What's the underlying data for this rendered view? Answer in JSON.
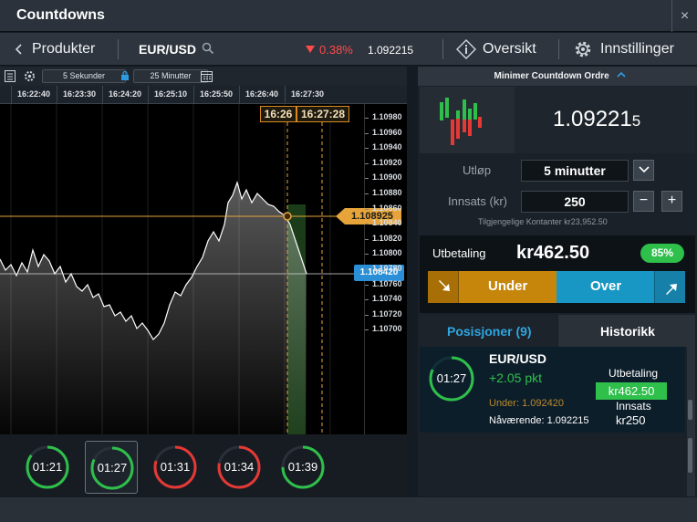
{
  "window": {
    "title": "Countdowns",
    "close_icon": "×"
  },
  "nav": {
    "back_label": "Produkter",
    "symbol": "EUR/USD",
    "change": "0.38%",
    "price": "1.092215",
    "overview_label": "Oversikt",
    "settings_label": "Innstillinger"
  },
  "chart_toolbar": {
    "interval": "5 Sekunder",
    "duration": "25 Minutter"
  },
  "time_axis": [
    "16:22:40",
    "16:23:30",
    "16:24:20",
    "16:25:10",
    "16:25:50",
    "16:26:40",
    "16:27:30"
  ],
  "marker_times": {
    "entry": "16:26",
    "expiry": "16:27:28"
  },
  "y_axis": [
    "1.10980",
    "1.10960",
    "1.10940",
    "1.10920",
    "1.10900",
    "1.10880",
    "1.10860",
    "1.10840",
    "1.10820",
    "1.10800",
    "1.10780",
    "1.10760",
    "1.10740",
    "1.10720",
    "1.10700"
  ],
  "price_tags": {
    "strike": "1.108925",
    "current": "1.108420"
  },
  "timers": [
    "01:21",
    "01:27",
    "01:31",
    "01:34",
    "01:39"
  ],
  "timer_progress": [
    0.85,
    0.82,
    0.8,
    0.78,
    0.75
  ],
  "order": {
    "header": "Minimer Countdown Ordre",
    "big_price_main": "1.09221",
    "big_price_small": "5",
    "expiry_label": "Utløp",
    "expiry_value": "5 minutter",
    "stake_label": "Innsats (kr)",
    "stake_value": "250",
    "available": "Tilgjengelige Kontanter kr23,952.50",
    "payout_label": "Utbetaling",
    "payout_value": "kr462.50",
    "payout_pct": "85%",
    "under_label": "Under",
    "over_label": "Over",
    "minus": "−",
    "plus": "+"
  },
  "tabs": {
    "positions": "Posisjoner (9)",
    "history": "Historikk"
  },
  "position": {
    "timer": "01:27",
    "symbol": "EUR/USD",
    "pips": "+2.05 pkt",
    "under_line": "Under: 1.092420",
    "current_line": "Nåværende: 1.092215",
    "payout_label": "Utbetaling",
    "payout_value": "kr462.50",
    "stake_label": "Innsats",
    "stake_value": "kr250"
  },
  "colors": {
    "accent_green": "#2fbf4b",
    "under": "#c6860c",
    "over": "#1896c4",
    "down": "#ff4b4b"
  }
}
